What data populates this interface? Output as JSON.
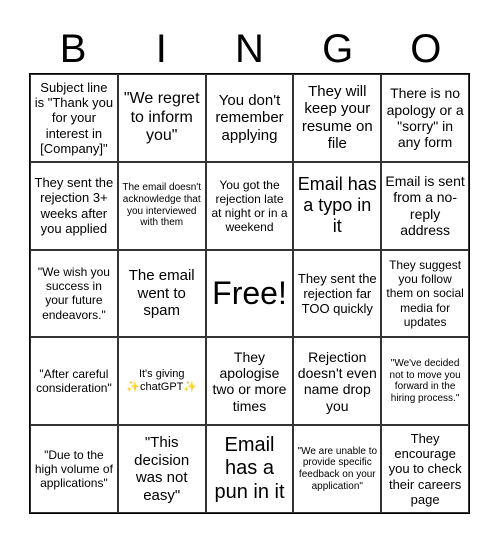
{
  "header": {
    "letters": [
      "B",
      "I",
      "N",
      "G",
      "O"
    ]
  },
  "cells": [
    [
      "Subject line is \"Thank you for your interest in [Company]\"",
      "\"We regret to inform you\"",
      "You don't remember applying",
      "They will keep your resume on file",
      "There is no apology or a \"sorry\" in any form"
    ],
    [
      "They sent the rejection 3+ weeks after you applied",
      "The email doesn't acknowledge that you interviewed with them",
      "You got the rejection late at night or in a weekend",
      "Email has a typo in it",
      "Email is sent from a no-reply address"
    ],
    [
      "\"We wish you success in your future endeavors.\"",
      "The email went to spam",
      "Free!",
      "They sent the rejection far TOO quickly",
      "They suggest you follow them on social media for updates"
    ],
    [
      "\"After careful consideration\"",
      "It's giving ✨chatGPT✨",
      "They apologise two or more times",
      "Rejection doesn't even name drop you",
      "\"We've decided not to move you forward in the hiring process.\""
    ],
    [
      "\"Due to the high volume of applications\"",
      "\"This decision was not easy\"",
      "Email has a pun in it",
      "\"We are unable to provide specific feedback on your application\"",
      "They encourage you to check their careers page"
    ]
  ]
}
